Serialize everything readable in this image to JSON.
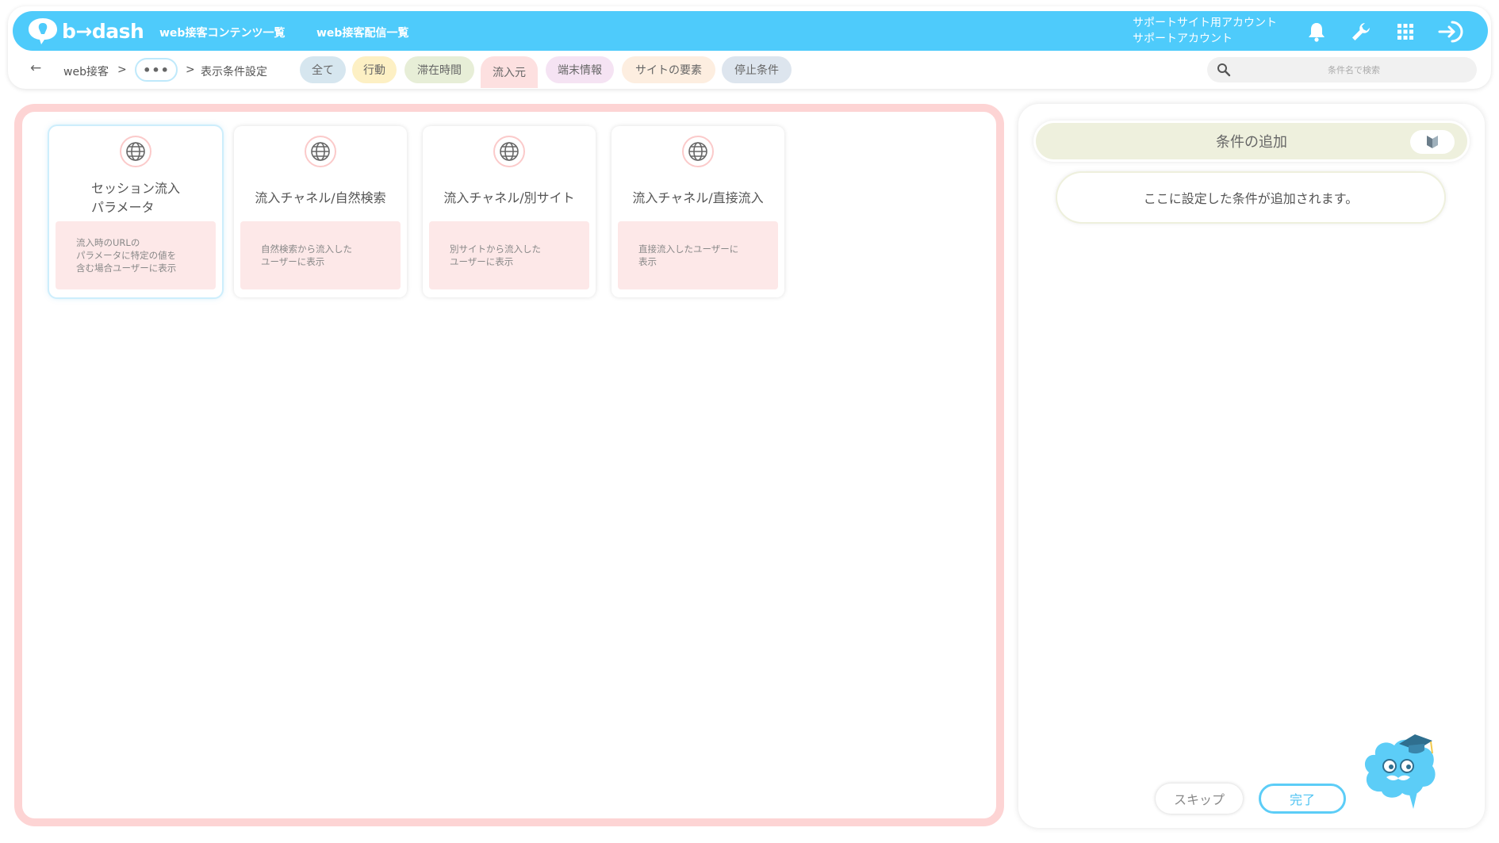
{
  "header": {
    "brand": "b→dash",
    "nav": [
      "web接客コンテンツ一覧",
      "web接客配信一覧"
    ],
    "account_line1": "サポートサイト用アカウント",
    "account_line2": "サポートアカウント",
    "icons": [
      "bell-icon",
      "wrench-icon",
      "grid-icon",
      "logout-icon"
    ]
  },
  "breadcrumb": {
    "back": "←",
    "item1": "web接客",
    "sep": ">",
    "more": "•••",
    "current": "表示条件設定"
  },
  "filters": [
    {
      "label": "全て",
      "color": "#d6e6ef"
    },
    {
      "label": "行動",
      "color": "#fdf0c4"
    },
    {
      "label": "滞在時間",
      "color": "#e7eed7"
    },
    {
      "label": "流入元",
      "color": "#fde0e0",
      "active": true
    },
    {
      "label": "端末情報",
      "color": "#f5e3f3"
    },
    {
      "label": "サイトの要素",
      "color": "#fdeee0"
    },
    {
      "label": "停止条件",
      "color": "#dde5ee"
    }
  ],
  "search": {
    "placeholder": "条件名で検索"
  },
  "cards": [
    {
      "title": "セッション流入\nパラメータ",
      "desc": "流入時のURLの\nパラメータに特定の値を\n含む場合ユーザーに表示",
      "selected": true
    },
    {
      "title": "流入チャネル/自然検索",
      "desc": "自然検索から流入した\nユーザーに表示"
    },
    {
      "title": "流入チャネル/別サイト",
      "desc": "別サイトから流入した\nユーザーに表示"
    },
    {
      "title": "流入チャネル/直接流入",
      "desc": "直接流入したユーザーに\n表示"
    }
  ],
  "conditions": {
    "title": "条件の追加",
    "placeholder": "ここに設定した条件が追加されます。"
  },
  "buttons": {
    "skip": "スキップ",
    "done": "完了"
  },
  "colors": {
    "brand": "#4ecbfb",
    "panel_border": "#fdd4d4",
    "card_desc_bg": "#fde8e8",
    "conditions_bg": "#eef0dd"
  }
}
